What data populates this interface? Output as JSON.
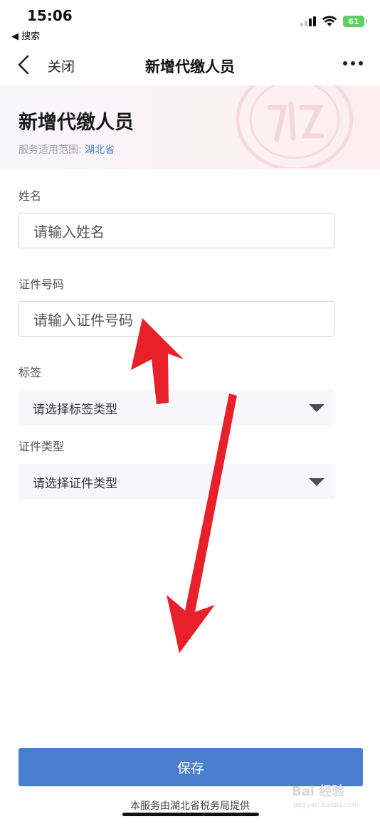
{
  "status_bar": {
    "time": "15:06",
    "back_app": "◀ 搜索",
    "battery": "61"
  },
  "nav": {
    "close_label": "关闭",
    "title": "新增代缴人员"
  },
  "header": {
    "heading": "新增代缴人员",
    "scope_label": "服务适用范围: ",
    "scope_value": "湖北省"
  },
  "form": {
    "name": {
      "label": "姓名",
      "placeholder": "请输入姓名"
    },
    "id_number": {
      "label": "证件号码",
      "placeholder": "请输入证件号码"
    },
    "tag": {
      "label": "标签",
      "placeholder": "请选择标签类型"
    },
    "id_type": {
      "label": "证件类型",
      "placeholder": "请选择证件类型"
    }
  },
  "footer": {
    "save_label": "保存",
    "provider": "本服务由湖北省税务局提供"
  },
  "watermark": {
    "main": "Bai 经验",
    "sub": "jingyan.baidu.com"
  },
  "colors": {
    "accent": "#4a7fcf",
    "annotation_arrow": "#e8202a"
  }
}
